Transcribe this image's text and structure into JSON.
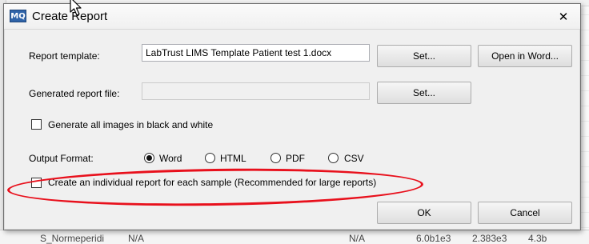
{
  "background": {
    "bottom_row": {
      "name": "S_Normeperidi",
      "value1": "N/A",
      "value2": "N/A",
      "value3": "6.0b1e3",
      "value4": "2.383e3",
      "value5": "4.3b"
    }
  },
  "dialog": {
    "title": "Create Report",
    "app_icon": "MQ",
    "close_glyph": "✕"
  },
  "report_template": {
    "label": "Report template:",
    "value": "LabTrust LIMS Template Patient test 1.docx",
    "set_button": "Set...",
    "open_button": "Open in Word..."
  },
  "generated_file": {
    "label": "Generated report file:",
    "value": "",
    "set_button": "Set..."
  },
  "bw_option": {
    "label": "Generate all images in black and white",
    "checked": false
  },
  "output_format": {
    "label": "Output Format:",
    "options": [
      "Word",
      "HTML",
      "PDF",
      "CSV"
    ],
    "selected": "Word"
  },
  "individual_report": {
    "label": "Create an individual report for each sample (Recommended for large reports)",
    "checked": false
  },
  "buttons": {
    "ok": "OK",
    "cancel": "Cancel"
  },
  "annotation_color": "#e8101c"
}
